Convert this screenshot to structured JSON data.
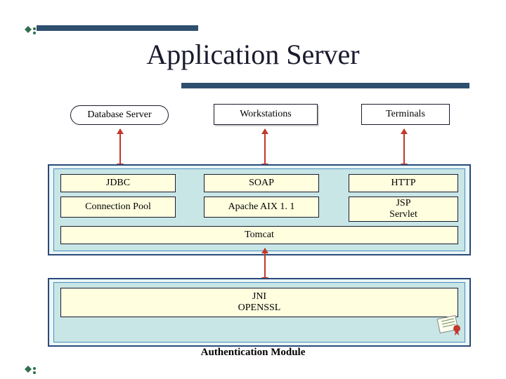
{
  "title": "Application Server",
  "clients": {
    "database": "Database Server",
    "workstations": "Workstations",
    "terminals": "Terminals"
  },
  "protocols": {
    "jdbc": "JDBC",
    "soap": "SOAP",
    "http": "HTTP"
  },
  "middleware": {
    "connection_pool": "Connection Pool",
    "apache": "Apache AIX 1. 1",
    "jsp_servlet": "JSP\nServlet",
    "tomcat": "Tomcat"
  },
  "lower": {
    "jni": "JNI",
    "openssl": "OPENSSL",
    "auth_module": "Authentication Module"
  }
}
